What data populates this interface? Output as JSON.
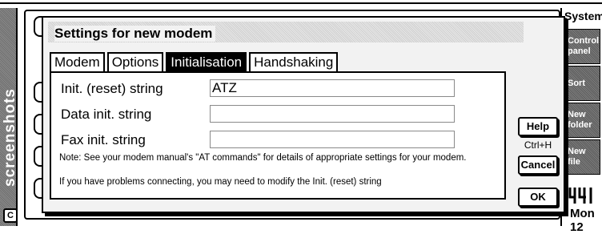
{
  "side_strip": {
    "label": "screenshots",
    "corner_label": "C"
  },
  "system": {
    "title": "System",
    "buttons": [
      "Control panel",
      "Sort",
      "New folder",
      "New file"
    ],
    "date": "Mon 12"
  },
  "dialog": {
    "title": "Settings for new modem",
    "tabs": [
      {
        "label": "Modem",
        "active": false
      },
      {
        "label": "Options",
        "active": false
      },
      {
        "label": "Initialisation",
        "active": true
      },
      {
        "label": "Handshaking",
        "active": false
      }
    ],
    "fields": [
      {
        "label": "Init. (reset) string",
        "value": "ATZ"
      },
      {
        "label": "Data init. string",
        "value": ""
      },
      {
        "label": "Fax init. string",
        "value": ""
      }
    ],
    "note1": "Note: See your modem manual's \"AT commands\" for details of appropriate settings for your modem.",
    "note2": "If you have problems connecting, you may need to modify the Init. (reset) string",
    "buttons": {
      "help": "Help",
      "help_shortcut": "Ctrl+H",
      "cancel": "Cancel",
      "ok": "OK"
    }
  }
}
